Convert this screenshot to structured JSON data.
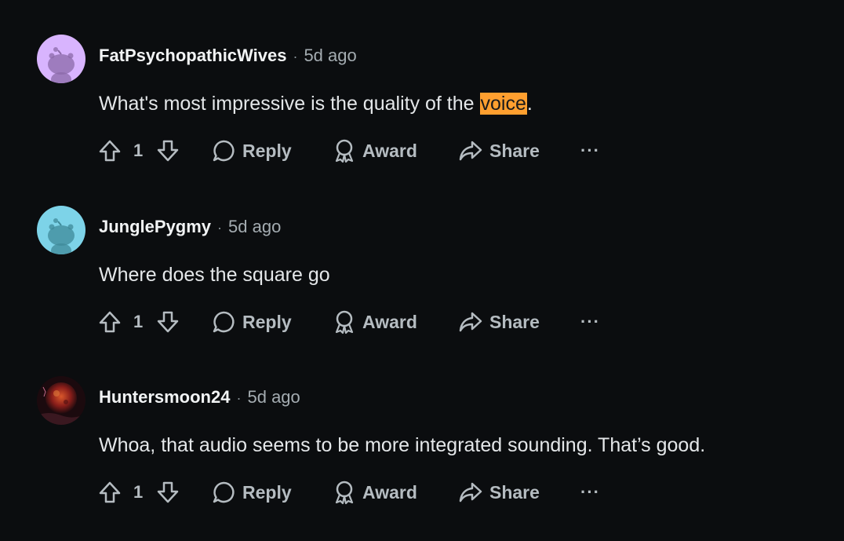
{
  "comments": [
    {
      "username": "FatPsychopathicWives",
      "separator": "·",
      "time": "5d ago",
      "text_before": "What's most impressive is the quality of the ",
      "highlight": "voice",
      "text_after": ".",
      "score": "1",
      "avatar_color": "#d8b4fe"
    },
    {
      "username": "JunglePygmy",
      "separator": "·",
      "time": "5d ago",
      "text": "Where does the square go",
      "score": "1",
      "avatar_color": "#7dd3e8"
    },
    {
      "username": "Huntersmoon24",
      "separator": "·",
      "time": "5d ago",
      "text": "Whoa, that audio seems to be more integrated sounding. That’s good.",
      "score": "1",
      "avatar_color": "#7a1f1f"
    }
  ],
  "actions": {
    "reply": "Reply",
    "award": "Award",
    "share": "Share",
    "more": "···"
  },
  "colors": {
    "background": "#0b0d0f",
    "highlight": "#ff9f2f",
    "action_text": "#b5bcc1"
  }
}
